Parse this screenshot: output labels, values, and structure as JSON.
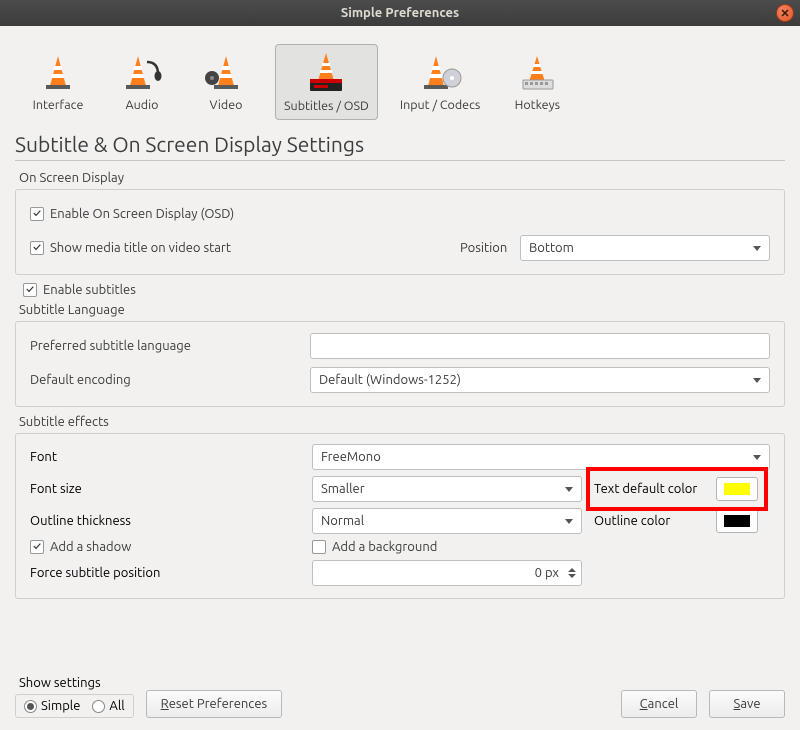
{
  "window": {
    "title": "Simple Preferences"
  },
  "tabs": {
    "interface": "Interface",
    "audio": "Audio",
    "video": "Video",
    "subtitles": "Subtitles / OSD",
    "codecs": "Input / Codecs",
    "hotkeys": "Hotkeys"
  },
  "page": {
    "title": "Subtitle & On Screen Display Settings"
  },
  "osd": {
    "section": "On Screen Display",
    "enable": "Enable On Screen Display (OSD)",
    "show_title": "Show media title on video start",
    "position_label": "Position",
    "position_value": "Bottom"
  },
  "subs": {
    "enable": "Enable subtitles",
    "lang_section": "Subtitle Language",
    "pref_lang": "Preferred subtitle language",
    "pref_lang_value": "",
    "encoding": "Default encoding",
    "encoding_value": "Default (Windows-1252)"
  },
  "effects": {
    "section": "Subtitle effects",
    "font": "Font",
    "font_value": "FreeMono",
    "fontsize": "Font size",
    "fontsize_value": "Smaller",
    "text_color": "Text default color",
    "text_color_value": "#ffff00",
    "outline_thickness": "Outline thickness",
    "outline_thickness_value": "Normal",
    "outline_color": "Outline color",
    "outline_color_value": "#000000",
    "shadow": "Add a shadow",
    "background": "Add a background",
    "force_pos": "Force subtitle position",
    "force_pos_value": "0 px"
  },
  "footer": {
    "show_settings": "Show settings",
    "simple": "Simple",
    "all": "All",
    "reset": "Reset Preferences",
    "cancel": "Cancel",
    "save": "Save"
  }
}
